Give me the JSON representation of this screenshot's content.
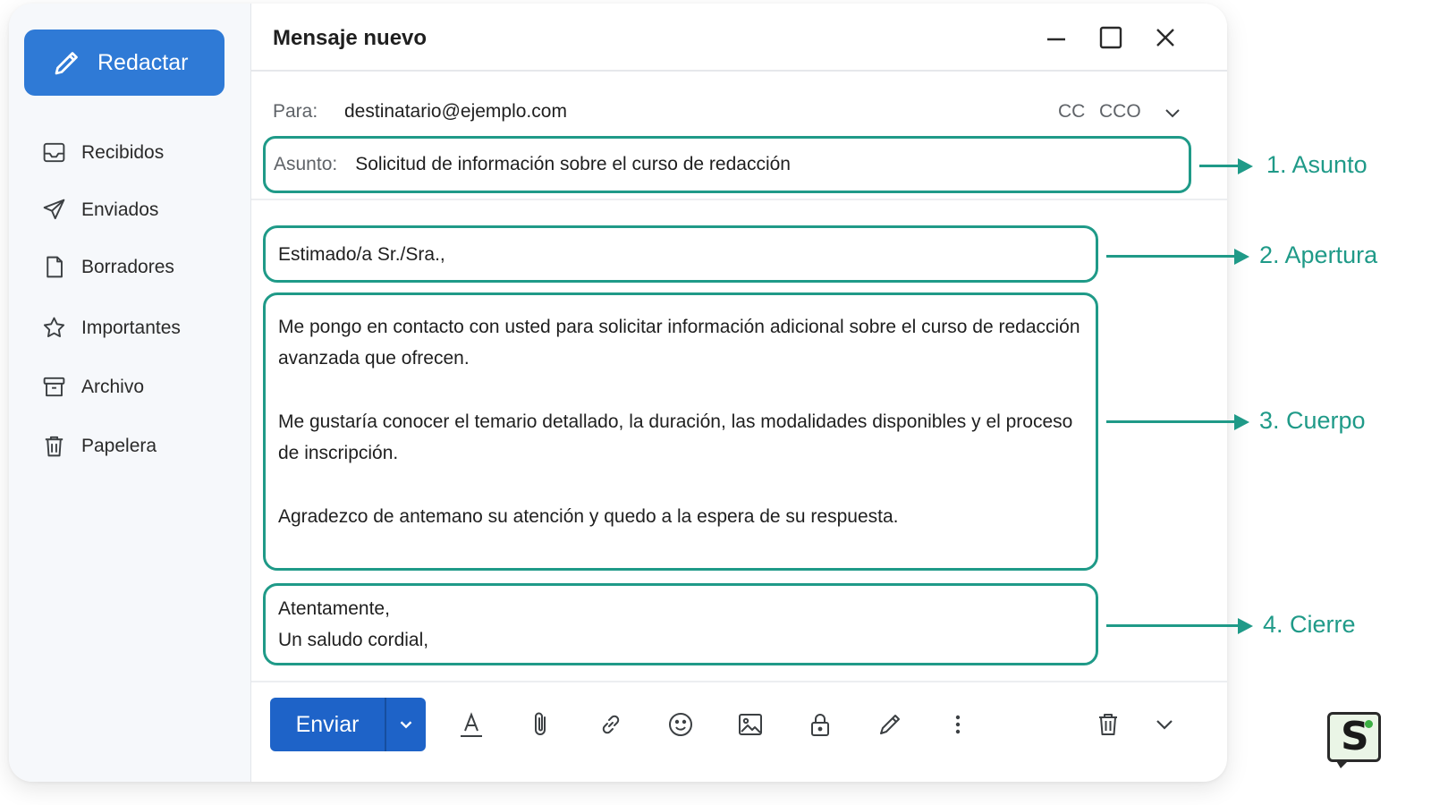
{
  "sidebar": {
    "compose_label": "Redactar",
    "items": [
      {
        "label": "Recibidos",
        "icon": "inbox-icon"
      },
      {
        "label": "Enviados",
        "icon": "send-icon"
      },
      {
        "label": "Borradores",
        "icon": "draft-icon"
      },
      {
        "label": "Importantes",
        "icon": "star-icon"
      },
      {
        "label": "Archivo",
        "icon": "archive-icon"
      },
      {
        "label": "Papelera",
        "icon": "trash-icon"
      }
    ]
  },
  "compose": {
    "title": "Mensaje nuevo",
    "to_label": "Para:",
    "to_value": "destinatario@ejemplo.com",
    "cc_label": "CC",
    "bcc_label": "CCO",
    "subject_label": "Asunto:",
    "subject_value": "Solicitud de información sobre el curso de redacción",
    "greeting": "Estimado/a Sr./Sra.,",
    "body": [
      "Me pongo en contacto con usted para solicitar información adicional sobre el curso de redacción avanzada que ofrecen.",
      "Me gustaría conocer el temario detallado, la duración, las modalidades disponibles y el proceso de inscripción.",
      "Agradezco de antemano su atención y quedo a la espera de su respuesta."
    ],
    "closing": [
      "Atentamente,",
      "Un saludo cordial,"
    ],
    "send_label": "Enviar"
  },
  "annotations": [
    "1. Asunto",
    "2. Apertura",
    "3. Cuerpo",
    "4. Cierre"
  ],
  "colors": {
    "accent": "#1f9a88",
    "compose_button": "#2f7ad6",
    "send_button": "#1e63c8"
  }
}
